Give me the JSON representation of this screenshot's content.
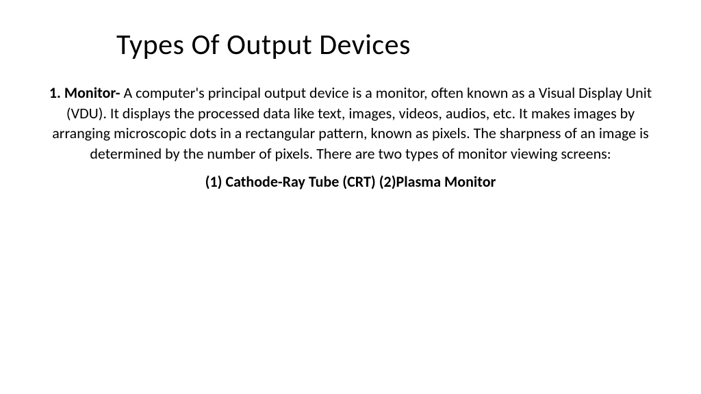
{
  "slide": {
    "title": "Types Of Output Devices",
    "body": {
      "lead": "1. Monitor- ",
      "content": "A computer's principal output device is a monitor, often known as a Visual Display Unit (VDU). It displays the processed data like text, images, videos, audios, etc. It makes images by arranging microscopic dots in a rectangular pattern, known as pixels. The sharpness of an image is determined by the number of pixels. There are two types of monitor viewing screens:"
    },
    "subtypes": "(1)  Cathode-Ray Tube (CRT) (2)Plasma Monitor"
  }
}
